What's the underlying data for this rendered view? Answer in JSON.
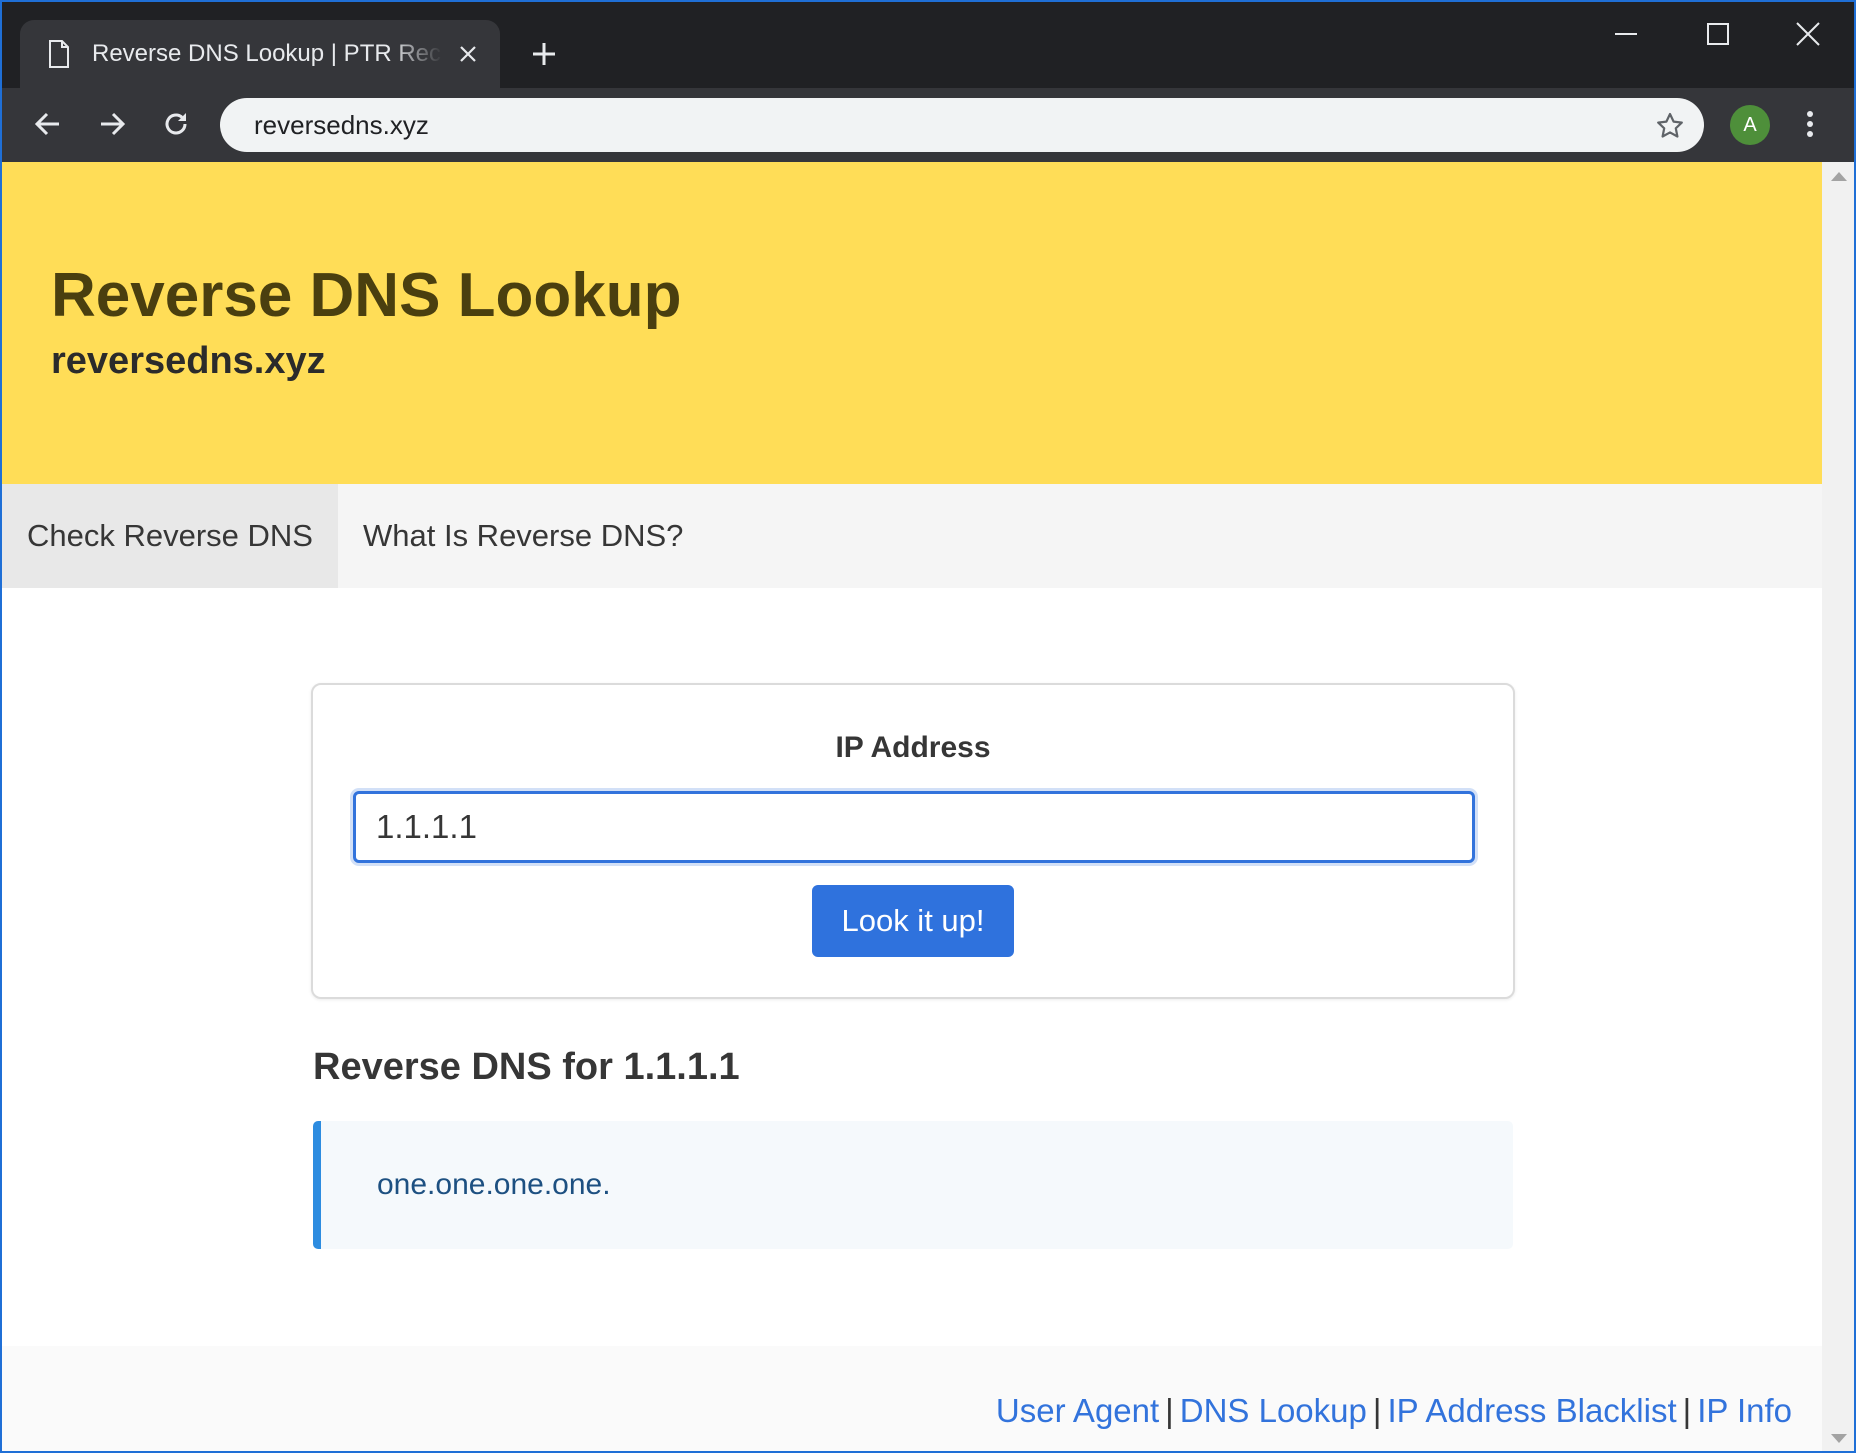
{
  "browser": {
    "tab_title": "Reverse DNS Lookup | PTR Record Lookup",
    "url": "reversedns.xyz",
    "profile_initial": "A"
  },
  "icons": {
    "tab": "page-icon",
    "tab_close": "close-icon",
    "new_tab": "plus-icon",
    "minimize": "minimize-icon",
    "maximize": "maximize-icon",
    "close": "close-icon",
    "back": "arrow-left-icon",
    "forward": "arrow-right-icon",
    "reload": "reload-icon",
    "bookmark": "star-icon",
    "menu": "more-vertical-icon"
  },
  "colors": {
    "hero_bg": "#ffdd57",
    "primary": "#3273dc",
    "info_border": "#2d8ce0",
    "avatar": "#4e8f3a"
  },
  "hero": {
    "title": "Reverse DNS Lookup",
    "subtitle": "reversedns.xyz"
  },
  "nav": {
    "tabs": [
      {
        "label": "Check Reverse DNS",
        "active": true
      },
      {
        "label": "What Is Reverse DNS?",
        "active": false
      }
    ]
  },
  "form": {
    "label": "IP Address",
    "value": "1.1.1.1",
    "button": "Look it up!"
  },
  "result": {
    "heading": "Reverse DNS for 1.1.1.1",
    "value": "one.one.one.one."
  },
  "footer": {
    "links": [
      "User Agent",
      "DNS Lookup",
      "IP Address Blacklist",
      "IP Info"
    ],
    "separator": "|"
  }
}
